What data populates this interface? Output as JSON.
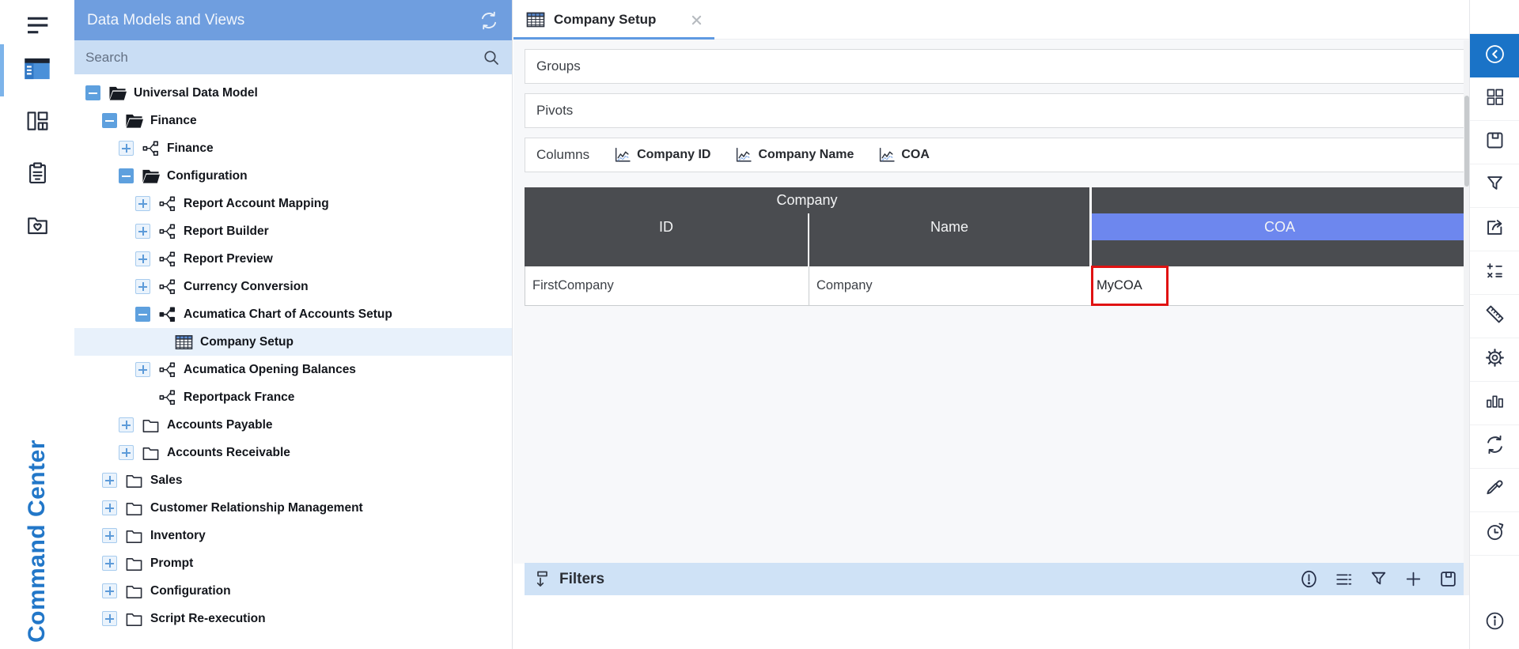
{
  "app": {
    "command_center_label": "Command Center"
  },
  "left_rail": {
    "items": [
      {
        "name": "hamburger-menu-button",
        "icon": "hamburger"
      },
      {
        "name": "nav-data-models",
        "icon": "panel-active",
        "active": true
      },
      {
        "name": "nav-dashboards",
        "icon": "layout"
      },
      {
        "name": "nav-reports",
        "icon": "clipboard"
      },
      {
        "name": "nav-favorites",
        "icon": "folder-heart"
      }
    ]
  },
  "tree_panel": {
    "title": "Data Models and Views",
    "search_placeholder": "Search",
    "items": [
      {
        "label": "Universal Data Model",
        "level": 0,
        "expander": "minus",
        "icon": "folder-open"
      },
      {
        "label": "Finance",
        "level": 1,
        "expander": "minus",
        "icon": "folder-open"
      },
      {
        "label": "Finance",
        "level": 2,
        "expander": "plus",
        "icon": "view"
      },
      {
        "label": "Configuration",
        "level": 2,
        "expander": "minus",
        "icon": "folder-open"
      },
      {
        "label": "Report Account Mapping",
        "level": 3,
        "expander": "plus",
        "icon": "view"
      },
      {
        "label": "Report Builder",
        "level": 3,
        "expander": "plus",
        "icon": "view"
      },
      {
        "label": "Report Preview",
        "level": 3,
        "expander": "plus",
        "icon": "view"
      },
      {
        "label": "Currency Conversion",
        "level": 3,
        "expander": "plus",
        "icon": "view"
      },
      {
        "label": "Acumatica Chart of Accounts Setup",
        "level": 3,
        "expander": "minus",
        "icon": "view-filled"
      },
      {
        "label": "Company Setup",
        "level": 4,
        "expander": "none",
        "icon": "table",
        "selected": true
      },
      {
        "label": "Acumatica Opening Balances",
        "level": 3,
        "expander": "plus",
        "icon": "view"
      },
      {
        "label": "Reportpack France",
        "level": 3,
        "expander": "none",
        "icon": "view"
      },
      {
        "label": "Accounts Payable",
        "level": 2,
        "expander": "plus",
        "icon": "folder-closed"
      },
      {
        "label": "Accounts Receivable",
        "level": 2,
        "expander": "plus",
        "icon": "folder-closed"
      },
      {
        "label": "Sales",
        "level": 1,
        "expander": "plus",
        "icon": "folder-closed"
      },
      {
        "label": "Customer Relationship Management",
        "level": 1,
        "expander": "plus",
        "icon": "folder-closed"
      },
      {
        "label": "Inventory",
        "level": 1,
        "expander": "plus",
        "icon": "folder-closed"
      },
      {
        "label": "Prompt",
        "level": 1,
        "expander": "plus",
        "icon": "folder-closed"
      },
      {
        "label": "Configuration",
        "level": 1,
        "expander": "plus",
        "icon": "folder-closed"
      },
      {
        "label": "Script Re-execution",
        "level": 1,
        "expander": "plus",
        "icon": "folder-closed"
      }
    ]
  },
  "main": {
    "tab": {
      "title": "Company Setup"
    },
    "sections": {
      "groups_label": "Groups",
      "pivots_label": "Pivots",
      "columns_label": "Columns"
    },
    "column_chips": [
      {
        "label": "Company ID"
      },
      {
        "label": "Company Name"
      },
      {
        "label": "COA"
      }
    ],
    "table": {
      "group_header": "Company",
      "columns": [
        "ID",
        "Name",
        "COA"
      ],
      "selected_column": "COA",
      "rows": [
        {
          "id": "FirstCompany",
          "name": "Company",
          "coa": "MyCOA"
        }
      ],
      "highlighted_cell": {
        "row": 0,
        "column": "COA",
        "value": "MyCOA"
      }
    },
    "filters_bar": {
      "label": "Filters",
      "left_icon": "filter-down",
      "buttons": [
        {
          "name": "errors-button",
          "icon": "exclaim"
        },
        {
          "name": "filter-list-button",
          "icon": "list"
        },
        {
          "name": "add-filter-funnel-button",
          "icon": "funnel"
        },
        {
          "name": "add-button",
          "icon": "plus"
        },
        {
          "name": "save-filters-button",
          "icon": "save"
        }
      ]
    }
  },
  "right_rail": {
    "items": [
      {
        "name": "collapse-panel-button",
        "icon": "chev-circle",
        "active": true
      },
      {
        "name": "dashboard-grid-button",
        "icon": "grid4"
      },
      {
        "name": "save-button",
        "icon": "save"
      },
      {
        "name": "filter-button",
        "icon": "funnel"
      },
      {
        "name": "export-button",
        "icon": "share"
      },
      {
        "name": "calculations-button",
        "icon": "calc"
      },
      {
        "name": "measure-button",
        "icon": "ruler"
      },
      {
        "name": "settings-button",
        "icon": "gear"
      },
      {
        "name": "charts-button",
        "icon": "bars"
      },
      {
        "name": "refresh-button",
        "icon": "refresh"
      },
      {
        "name": "color-picker-button",
        "icon": "dropper"
      },
      {
        "name": "history-button",
        "icon": "clock"
      }
    ],
    "info_button": {
      "name": "info-button",
      "icon": "info"
    }
  },
  "colors": {
    "panel_header_blue": "#6f9edf",
    "search_bg": "#c9ddf4",
    "selected_row_bg": "#e8f1fb",
    "table_header_gray": "#4a4c50",
    "selected_column_blue": "#6d87ee",
    "cell_highlight_red": "#e01212",
    "filters_bar_bg": "#cfe2f6",
    "accent_blue": "#2277c8"
  }
}
